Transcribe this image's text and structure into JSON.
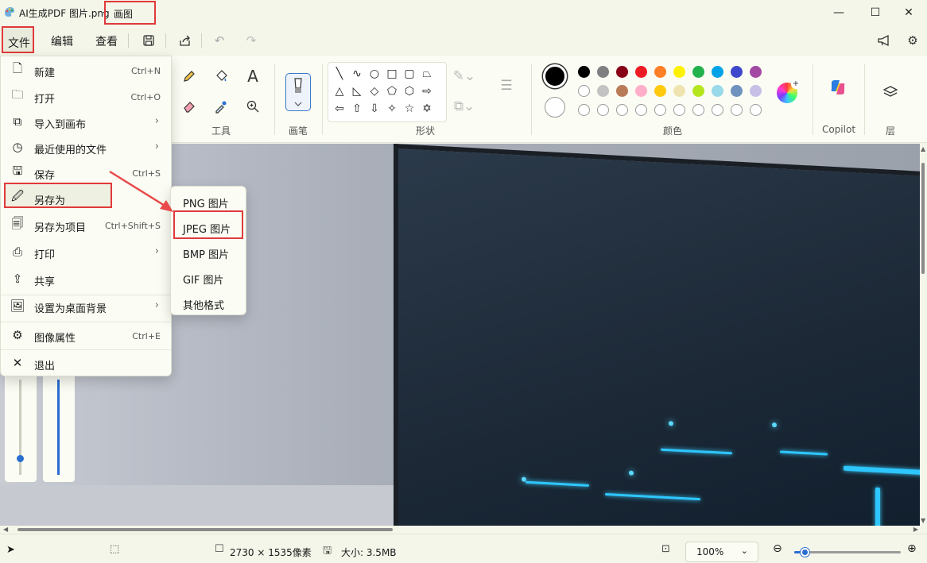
{
  "titlebar": {
    "document": "AI生成PDF 图片.png",
    "separator": "-",
    "app_name": "画图",
    "minimize": "—",
    "maximize": "☐",
    "close": "✕"
  },
  "menubar": {
    "file": "文件",
    "edit": "编辑",
    "view": "查看"
  },
  "ribbon": {
    "tools_label": "工具",
    "brush_label": "画笔",
    "shapes_label": "形状",
    "colors_label": "颜色",
    "copilot_label": "Copilot",
    "layers_label": "层"
  },
  "colors": {
    "primary": "#000000",
    "secondary": "#ffffff",
    "row1": [
      "#000000",
      "#7f7f7f",
      "#880015",
      "#ed1c24",
      "#ff7f27",
      "#fff200",
      "#22b14c",
      "#00a2e8",
      "#3f48cc",
      "#a349a4"
    ],
    "row2": [
      "#ffffff",
      "#c3c3c3",
      "#b97a57",
      "#ffaec9",
      "#ffc90e",
      "#efe4b0",
      "#b5e61d",
      "#99d9ea",
      "#7092be",
      "#c8bfe7"
    ],
    "row3": [
      "#ffffff",
      "#ffffff",
      "#ffffff",
      "#ffffff",
      "#ffffff",
      "#ffffff",
      "#ffffff",
      "#ffffff",
      "#ffffff",
      "#ffffff"
    ]
  },
  "file_menu": {
    "items": [
      {
        "label": "新建",
        "shortcut": "Ctrl+N",
        "icon": "new-file-icon"
      },
      {
        "label": "打开",
        "shortcut": "Ctrl+O",
        "icon": "folder-icon"
      },
      {
        "label": "导入到画布",
        "shortcut": "",
        "icon": "import-icon"
      },
      {
        "label": "最近使用的文件",
        "shortcut": "",
        "icon": "clock-icon"
      },
      {
        "label": "保存",
        "shortcut": "Ctrl+S",
        "icon": "save-icon"
      },
      {
        "label": "另存为",
        "shortcut": "",
        "icon": "save-as-icon"
      },
      {
        "label": "另存为项目",
        "shortcut": "Ctrl+Shift+S",
        "icon": "save-project-icon"
      },
      {
        "label": "打印",
        "shortcut": "",
        "icon": "printer-icon"
      },
      {
        "label": "共享",
        "shortcut": "",
        "icon": "share-icon"
      },
      {
        "label": "设置为桌面背景",
        "shortcut": "",
        "icon": "wallpaper-icon"
      },
      {
        "label": "图像属性",
        "shortcut": "Ctrl+E",
        "icon": "image-properties-icon"
      },
      {
        "label": "退出",
        "shortcut": "",
        "icon": "close-icon"
      }
    ]
  },
  "save_as_submenu": {
    "items": [
      "PNG 图片",
      "JPEG 图片",
      "BMP 图片",
      "GIF 图片",
      "其他格式"
    ]
  },
  "statusbar": {
    "dimensions": "2730 × 1535像素",
    "size": "大小: 3.5MB",
    "zoom": "100%"
  },
  "zoom_level": 0.1
}
